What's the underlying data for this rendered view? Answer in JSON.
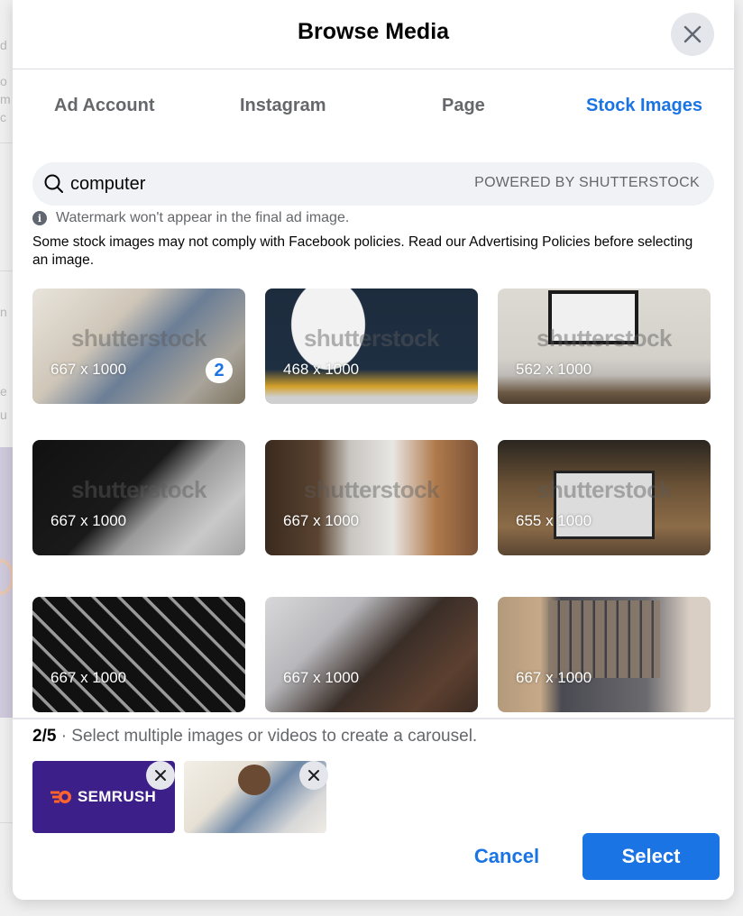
{
  "modal": {
    "title": "Browse Media",
    "close_label": "Close"
  },
  "tabs": [
    {
      "label": "Ad Account",
      "active": false
    },
    {
      "label": "Instagram",
      "active": false
    },
    {
      "label": "Page",
      "active": false
    },
    {
      "label": "Stock Images",
      "active": true
    }
  ],
  "search": {
    "value": "computer",
    "powered_by": "POWERED BY SHUTTERSTOCK"
  },
  "notes": {
    "watermark": "Watermark won't appear in the final ad image.",
    "policy": "Some stock images may not comply with Facebook policies. Read our Advertising Policies before selecting an image."
  },
  "images": [
    {
      "dims": "667 x 1000",
      "watermark": "shutterstock",
      "selected_order": "2",
      "description": "man with beard using laptop"
    },
    {
      "dims": "468 x 1000",
      "watermark": "shutterstock",
      "selected_order": null,
      "description": "top view laptop on round table"
    },
    {
      "dims": "562 x 1000",
      "watermark": "shutterstock",
      "selected_order": null,
      "description": "desktop monitor on desk"
    },
    {
      "dims": "667 x 1000",
      "watermark": "shutterstock",
      "selected_order": null,
      "description": "cmd key close-up"
    },
    {
      "dims": "667 x 1000",
      "watermark": "shutterstock",
      "selected_order": null,
      "description": "woman typing on laptop"
    },
    {
      "dims": "655 x 1000",
      "watermark": "shutterstock",
      "selected_order": null,
      "description": "laptop on wooden table"
    },
    {
      "dims": "667 x 1000",
      "watermark": "",
      "selected_order": null,
      "description": "keyboard keys close-up"
    },
    {
      "dims": "667 x 1000",
      "watermark": "",
      "selected_order": null,
      "description": "man typing on laptop"
    },
    {
      "dims": "667 x 1000",
      "watermark": "",
      "selected_order": null,
      "description": "video call on laptop"
    }
  ],
  "selection": {
    "count": "2/5",
    "hint": " · Select multiple images or videos to create a carousel.",
    "items": [
      {
        "label": "SEMRUSH",
        "brand_color": "#3d1f8a",
        "accent": "#ff642d"
      },
      {
        "label": "man with laptop"
      }
    ]
  },
  "actions": {
    "cancel": "Cancel",
    "select": "Select"
  },
  "colors": {
    "accent": "#1b74e4",
    "text_secondary": "#65676b"
  }
}
